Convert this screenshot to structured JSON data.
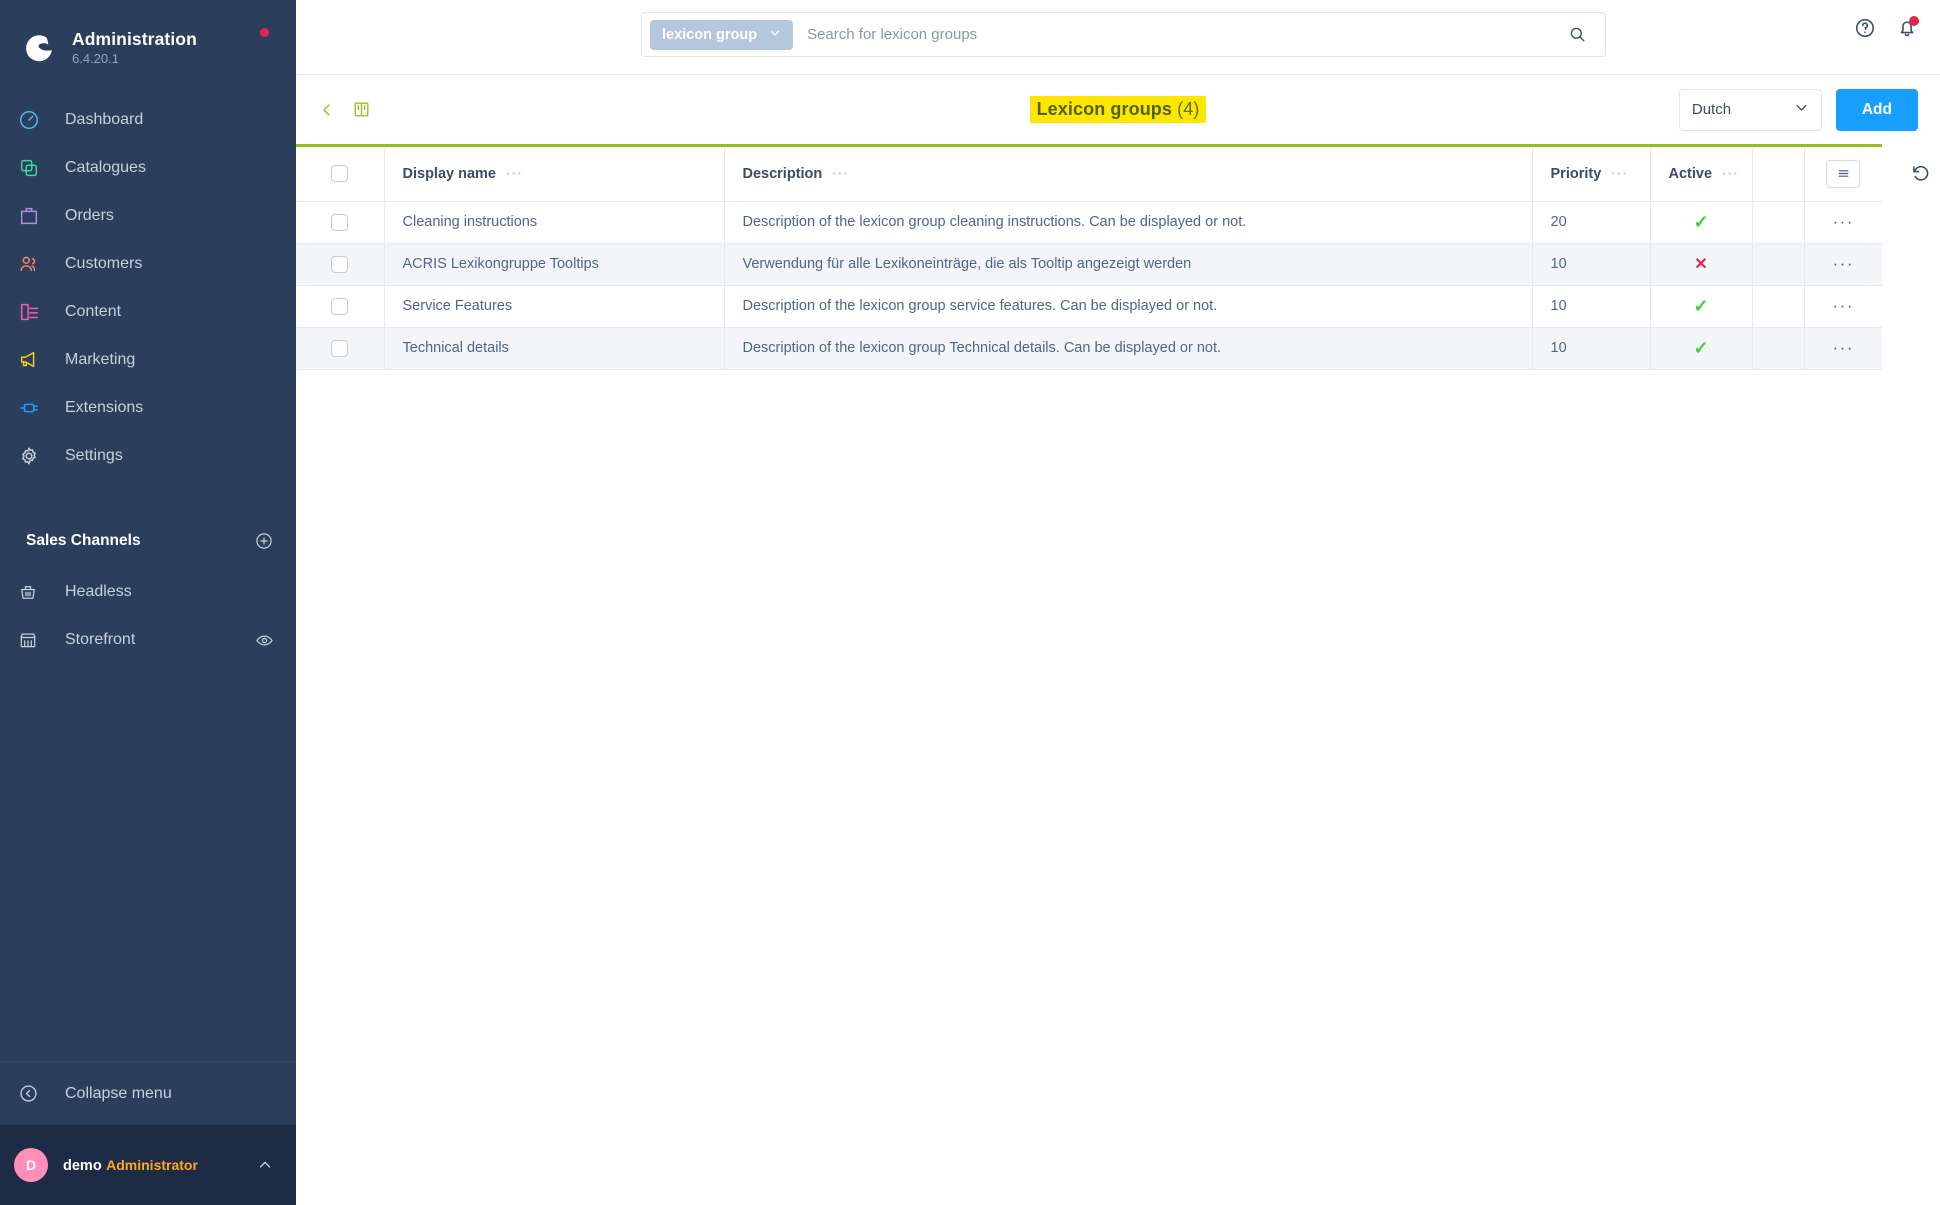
{
  "sidebar": {
    "brand": {
      "title": "Administration",
      "version": "6.4.20.1"
    },
    "items": [
      {
        "label": "Dashboard",
        "icon": "dashboard-icon",
        "color": "#5ab9ea"
      },
      {
        "label": "Catalogues",
        "icon": "catalogues-icon",
        "color": "#3ed6a0"
      },
      {
        "label": "Orders",
        "icon": "orders-icon",
        "color": "#a98fe0"
      },
      {
        "label": "Customers",
        "icon": "customers-icon",
        "color": "#f08a5d"
      },
      {
        "label": "Content",
        "icon": "content-icon",
        "color": "#f45bb5"
      },
      {
        "label": "Marketing",
        "icon": "marketing-icon",
        "color": "#f2d21b"
      },
      {
        "label": "Extensions",
        "icon": "extensions-icon",
        "color": "#189eff"
      },
      {
        "label": "Settings",
        "icon": "settings-icon",
        "color": "#c5d1e0"
      }
    ],
    "section_title": "Sales Channels",
    "channels": [
      {
        "label": "Headless",
        "icon": "basket-icon"
      },
      {
        "label": "Storefront",
        "icon": "storefront-icon"
      }
    ],
    "collapse_label": "Collapse menu",
    "user": {
      "initial": "D",
      "name": "demo",
      "role": "Administrator"
    }
  },
  "topbar": {
    "scope_chip": "lexicon group",
    "search_value": "",
    "search_placeholder": "Search for lexicon groups"
  },
  "page": {
    "title": "Lexicon groups",
    "count": "(4)",
    "language": "Dutch",
    "add_label": "Add"
  },
  "table": {
    "columns": [
      "Display name",
      "Description",
      "Priority",
      "Active"
    ],
    "dots": "···",
    "rows": [
      {
        "name": "Cleaning instructions",
        "description": "Description of the lexicon group cleaning instructions. Can be displayed or not.",
        "priority": "20",
        "active": true,
        "actions": "···"
      },
      {
        "name": "ACRIS Lexikongruppe Tooltips",
        "description": "Verwendung für alle Lexikoneinträge, die als Tooltip angezeigt werden",
        "priority": "10",
        "active": false,
        "actions": "···"
      },
      {
        "name": "Service Features",
        "description": "Description of the lexicon group service features. Can be displayed or not.",
        "priority": "10",
        "active": true,
        "actions": "···"
      },
      {
        "name": "Technical details",
        "description": "Description of the lexicon group Technical details. Can be displayed or not.",
        "priority": "10",
        "active": true,
        "actions": "···"
      }
    ],
    "active_true_glyph": "✓",
    "active_false_glyph": "✕"
  },
  "colors": {
    "sidebar_bg": "#2b3e5b",
    "accent_blue": "#189eff",
    "accent_green": "#94c11f",
    "highlight_yellow": "#ffe600",
    "danger_red": "#de294c",
    "success_green": "#37d039"
  }
}
